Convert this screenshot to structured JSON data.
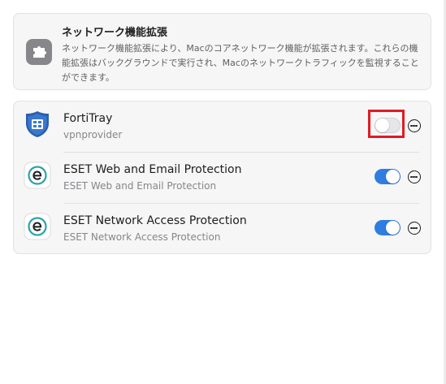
{
  "header": {
    "title": "ネットワーク機能拡張",
    "description": "ネットワーク機能拡張により、Macのコアネットワーク機能が拡張されます。これらの機能拡張はバックグラウンドで実行され、Macのネットワークトラフィックを監視することができます。",
    "icon": "extension-puzzle-icon"
  },
  "extensions": [
    {
      "name": "FortiTray",
      "subtitle": "vpnprovider",
      "enabled": false,
      "icon": "fortinet-shield-icon",
      "highlighted": true
    },
    {
      "name": "ESET Web and Email Protection",
      "subtitle": "ESET Web and Email Protection",
      "enabled": true,
      "icon": "eset-icon"
    },
    {
      "name": "ESET Network Access Protection",
      "subtitle": "ESET Network Access Protection",
      "enabled": true,
      "icon": "eset-icon"
    }
  ],
  "colors": {
    "toggle_on": "#2f7de1",
    "toggle_off": "#e5e5ea",
    "highlight": "#e01b24",
    "forti_blue": "#2b5fad",
    "eset_teal": "#2aa3a8"
  }
}
